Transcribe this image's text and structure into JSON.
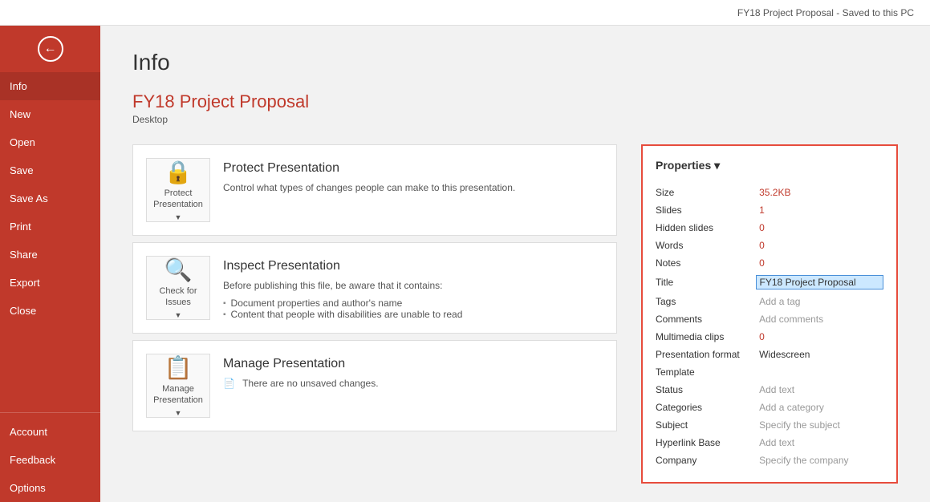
{
  "topbar": {
    "title": "FY18 Project Proposal  -  Saved to this PC"
  },
  "sidebar": {
    "back_icon": "←",
    "items": [
      {
        "id": "info",
        "label": "Info",
        "active": true
      },
      {
        "id": "new",
        "label": "New"
      },
      {
        "id": "open",
        "label": "Open"
      },
      {
        "id": "save",
        "label": "Save"
      },
      {
        "id": "save-as",
        "label": "Save As"
      },
      {
        "id": "print",
        "label": "Print"
      },
      {
        "id": "share",
        "label": "Share"
      },
      {
        "id": "export",
        "label": "Export"
      },
      {
        "id": "close",
        "label": "Close"
      }
    ],
    "bottom_items": [
      {
        "id": "account",
        "label": "Account"
      },
      {
        "id": "feedback",
        "label": "Feedback"
      },
      {
        "id": "options",
        "label": "Options"
      }
    ]
  },
  "page": {
    "title": "Info"
  },
  "file": {
    "name": "FY18 Project Proposal",
    "location": "Desktop"
  },
  "cards": [
    {
      "id": "protect",
      "icon": "🔒",
      "icon_label": "Protect\nPresentation",
      "has_arrow": true,
      "title": "Protect Presentation",
      "description": "Control what types of changes people can make to this presentation.",
      "bullets": []
    },
    {
      "id": "check",
      "icon": "🔍",
      "icon_label": "Check for\nIssues",
      "has_arrow": true,
      "title": "Inspect Presentation",
      "description": "Before publishing this file, be aware that it contains:",
      "bullets": [
        "Document properties and author's name",
        "Content that people with disabilities are unable to read"
      ]
    },
    {
      "id": "manage",
      "icon": "📋",
      "icon_label": "Manage\nPresentation",
      "has_arrow": true,
      "title": "Manage Presentation",
      "description": "There are no unsaved changes.",
      "bullets": []
    }
  ],
  "properties": {
    "header": "Properties ▾",
    "rows": [
      {
        "label": "Size",
        "value": "35.2KB",
        "type": "accent"
      },
      {
        "label": "Slides",
        "value": "1",
        "type": "accent"
      },
      {
        "label": "Hidden slides",
        "value": "0",
        "type": "accent"
      },
      {
        "label": "Words",
        "value": "0",
        "type": "accent"
      },
      {
        "label": "Notes",
        "value": "0",
        "type": "accent"
      },
      {
        "label": "Title",
        "value": "FY18 Project Proposal",
        "type": "input"
      },
      {
        "label": "Tags",
        "value": "Add a tag",
        "type": "muted"
      },
      {
        "label": "Comments",
        "value": "Add comments",
        "type": "muted"
      },
      {
        "label": "Multimedia clips",
        "value": "0",
        "type": "accent"
      },
      {
        "label": "Presentation format",
        "value": "Widescreen",
        "type": "black"
      },
      {
        "label": "Template",
        "value": "",
        "type": "black"
      },
      {
        "label": "Status",
        "value": "Add text",
        "type": "muted"
      },
      {
        "label": "Categories",
        "value": "Add a category",
        "type": "muted"
      },
      {
        "label": "Subject",
        "value": "Specify the subject",
        "type": "muted"
      },
      {
        "label": "Hyperlink Base",
        "value": "Add text",
        "type": "muted"
      },
      {
        "label": "Company",
        "value": "Specify the company",
        "type": "muted"
      }
    ]
  }
}
